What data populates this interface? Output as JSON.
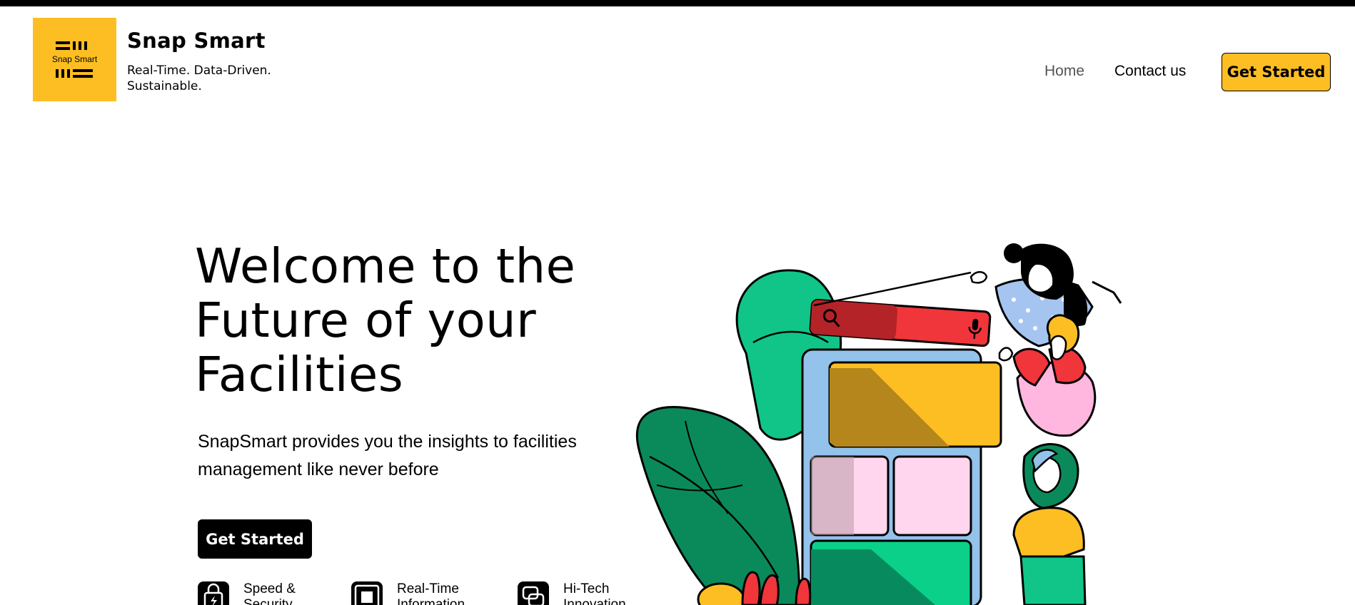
{
  "header": {
    "logo_text": "Snap Smart",
    "brand_name": "Snap Smart",
    "tagline": "Real-Time. Data-Driven. Sustainable.",
    "nav": {
      "home": "Home",
      "contact": "Contact us",
      "cta": "Get Started"
    }
  },
  "hero": {
    "title": "Welcome to the Future of your Facilities",
    "description": "SnapSmart provides you the insights to facilities management like never before",
    "cta": "Get Started",
    "features": [
      {
        "label": "Speed & Security",
        "icon": "lock-bolt-icon"
      },
      {
        "label": "Real-Time Information",
        "icon": "monitor-icon"
      },
      {
        "label": "Hi-Tech Innovation",
        "icon": "chat-layers-icon"
      }
    ]
  },
  "colors": {
    "brand_yellow": "#fdbe23",
    "black": "#000000",
    "illustration_green": "#0b9e6a",
    "illustration_red": "#f0353b",
    "illustration_blue": "#93c2ea",
    "illustration_pink": "#ffd6ee"
  }
}
